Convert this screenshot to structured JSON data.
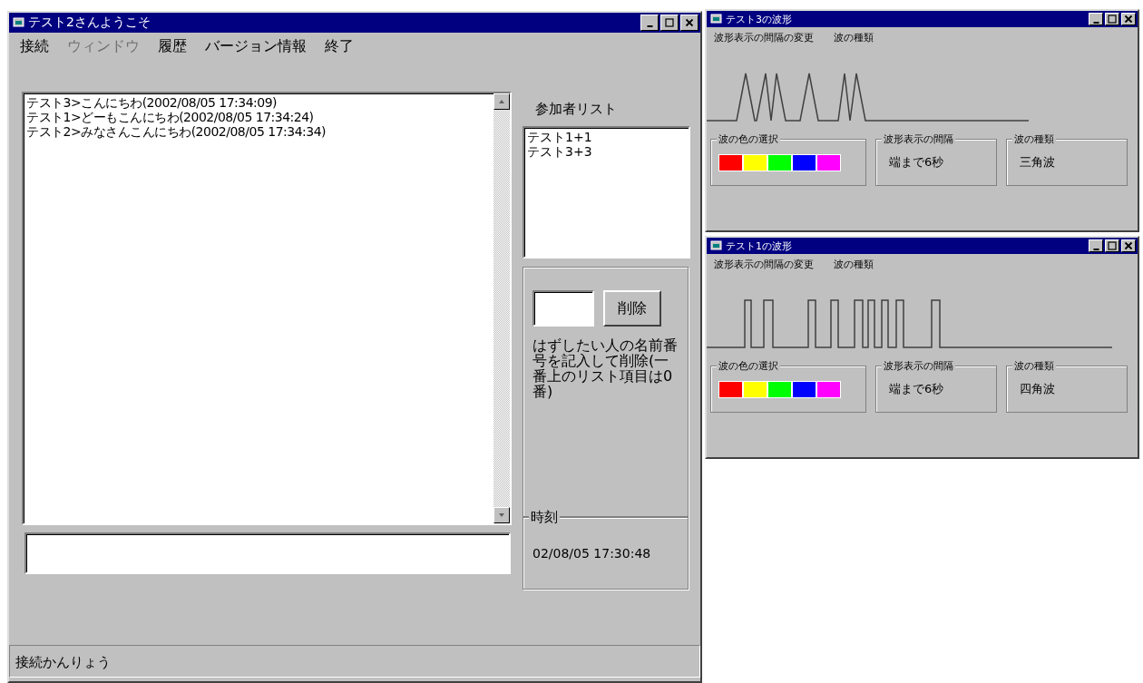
{
  "main_window": {
    "title": "テスト2さんようこそ",
    "menu": [
      {
        "label": "接続",
        "disabled": false
      },
      {
        "label": "ウィンドウ",
        "disabled": true
      },
      {
        "label": "履歴",
        "disabled": false
      },
      {
        "label": "バージョン情報",
        "disabled": false
      },
      {
        "label": "終了",
        "disabled": false
      }
    ],
    "messages": [
      "テスト3>こんにちわ(2002/08/05 17:34:09)",
      "テスト1>どーもこんにちわ(2002/08/05 17:34:24)",
      "テスト2>みなさんこんにちわ(2002/08/05 17:34:34)"
    ],
    "participants_label": "参加者リスト",
    "participants": [
      "テスト1+1",
      "テスト3+3"
    ],
    "delete_button": "削除",
    "delete_help": "はずしたい人の名前番号を記入して削除(一番上のリスト項目は0番)",
    "time_group": {
      "label": "時刻",
      "value": "02/08/05 17:30:48"
    },
    "status_bar": "接続かんりょう"
  },
  "wave_windows": [
    {
      "title": "テスト3の波形",
      "menu": [
        "波形表示の間隔の変更",
        "波の種類"
      ],
      "wave": {
        "kind": "triangle"
      },
      "color_group": "波の色の選択",
      "colors": [
        {
          "color": "#ff0000"
        },
        {
          "color": "#ffff00"
        },
        {
          "color": "#00ff00"
        },
        {
          "color": "#0000ff"
        },
        {
          "color": "#ff00ff"
        }
      ],
      "interval_group": {
        "label": "波形表示の間隔",
        "value": "端まで6秒"
      },
      "type_group": {
        "label": "波の種類",
        "value": "三角波"
      }
    },
    {
      "title": "テスト1の波形",
      "menu": [
        "波形表示の間隔の変更",
        "波の種類"
      ],
      "wave": {
        "kind": "square"
      },
      "color_group": "波の色の選択",
      "colors": [
        {
          "color": "#ff0000"
        },
        {
          "color": "#ffff00"
        },
        {
          "color": "#00ff00"
        },
        {
          "color": "#0000ff"
        },
        {
          "color": "#ff00ff"
        }
      ],
      "interval_group": {
        "label": "波形表示の間隔",
        "value": "端まで6秒"
      },
      "type_group": {
        "label": "波の種類",
        "value": "四角波"
      }
    }
  ]
}
